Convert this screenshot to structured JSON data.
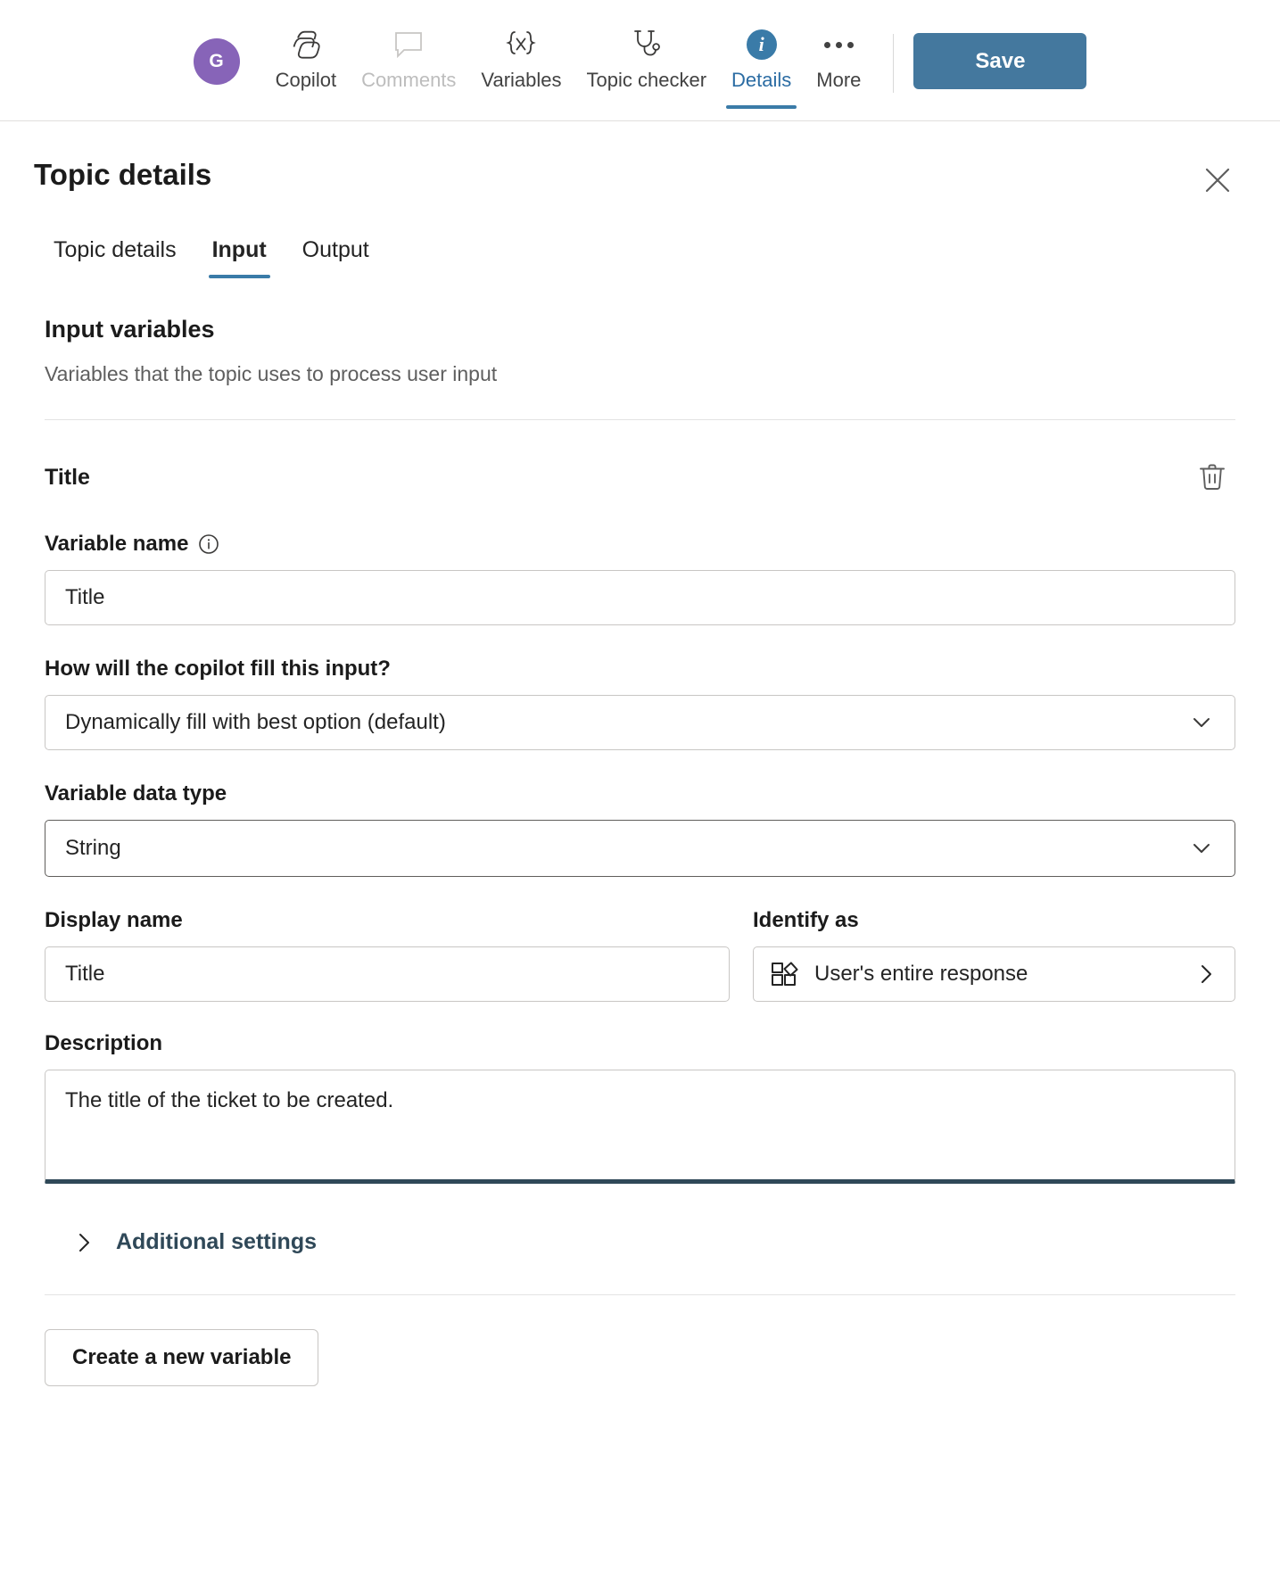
{
  "topbar": {
    "avatar_initial": "G",
    "items": [
      {
        "label": "Copilot",
        "icon": "copilot-icon",
        "state": "normal"
      },
      {
        "label": "Comments",
        "icon": "comment-icon",
        "state": "disabled"
      },
      {
        "label": "Variables",
        "icon": "variables-icon",
        "state": "normal"
      },
      {
        "label": "Topic checker",
        "icon": "stethoscope-icon",
        "state": "normal"
      },
      {
        "label": "Details",
        "icon": "info-circle-icon",
        "state": "active"
      },
      {
        "label": "More",
        "icon": "ellipsis-icon",
        "state": "normal"
      }
    ],
    "save_label": "Save",
    "accent_color": "#44789e",
    "avatar_color": "#8764b8",
    "active_color": "#3a7ba8"
  },
  "panel": {
    "title": "Topic details",
    "close_icon": "close-icon",
    "tabs": [
      {
        "label": "Topic details",
        "active": false
      },
      {
        "label": "Input",
        "active": true
      },
      {
        "label": "Output",
        "active": false
      }
    ]
  },
  "input_section": {
    "heading": "Input variables",
    "subheading": "Variables that the topic uses to process user input"
  },
  "variable": {
    "name_header": "Title",
    "delete_icon": "trash-icon",
    "variable_name": {
      "label": "Variable name",
      "info_icon": "info-icon",
      "value": "Title",
      "placeholder": "Variable name"
    },
    "fill_method": {
      "label": "How will the copilot fill this input?",
      "value": "Dynamically fill with best option (default)",
      "chevron_icon": "chevron-down-icon"
    },
    "data_type": {
      "label": "Variable data type",
      "value": "String",
      "chevron_icon": "chevron-down-icon"
    },
    "display_name": {
      "label": "Display name",
      "value": "Title",
      "placeholder": "Display name"
    },
    "identify_as": {
      "label": "Identify as",
      "value": "User's entire response",
      "entity_icon": "entity-icon",
      "arrow_icon": "chevron-right-icon"
    },
    "description": {
      "label": "Description",
      "value": "The title of the ticket to be created.",
      "placeholder": "Description"
    },
    "additional_settings": {
      "label": "Additional settings",
      "chevron_icon": "chevron-right-icon",
      "expanded": false
    }
  },
  "footer": {
    "create_variable_label": "Create a new variable"
  }
}
